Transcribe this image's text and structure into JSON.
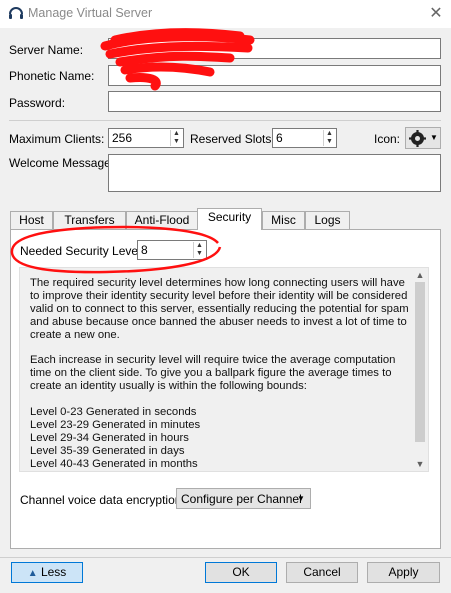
{
  "window": {
    "title": "Manage Virtual Server",
    "close_icon": "close-icon"
  },
  "server": {
    "name_label": "Server Name:",
    "name_value": "",
    "phonetic_label": "Phonetic Name:",
    "phonetic_value": "",
    "password_label": "Password:",
    "password_value": ""
  },
  "clients": {
    "max_label": "Maximum Clients:",
    "max_value": "256",
    "reserved_label": "Reserved Slots:",
    "reserved_value": "6",
    "icon_label": "Icon:",
    "icon_name": "gear-icon"
  },
  "welcome": {
    "label": "Welcome Message:",
    "value": ""
  },
  "tabs": [
    {
      "label": "Host"
    },
    {
      "label": "Transfers"
    },
    {
      "label": "Anti-Flood"
    },
    {
      "label": "Security",
      "active": true
    },
    {
      "label": "Misc"
    },
    {
      "label": "Logs"
    }
  ],
  "security": {
    "level_label": "Needed Security Level:",
    "level_value": "8",
    "description": [
      "The required security level determines how long connecting users will have to improve their identity security level before their identity will be considered valid on to connect to this server, essentially reducing the potential for spam and abuse because once banned the abuser needs to invest a lot of time to create a new one.",
      "Each increase in security level will require twice the average computation time on the client side. To give you a ballpark figure the average times to create an identity usually is within the following bounds:"
    ],
    "levels": [
      "Level 0-23 Generated in seconds",
      "Level 23-29 Generated in minutes",
      "Level 29-34 Generated in hours",
      "Level 35-39 Generated in days",
      "Level 40-43 Generated in months"
    ],
    "encryption_label": "Channel voice data encryption:",
    "encryption_value": "Configure per Channel"
  },
  "buttons": {
    "less": "Less",
    "ok": "OK",
    "cancel": "Cancel",
    "apply": "Apply"
  },
  "colors": {
    "accent": "#0078d7",
    "annotation": "#ff0000"
  }
}
